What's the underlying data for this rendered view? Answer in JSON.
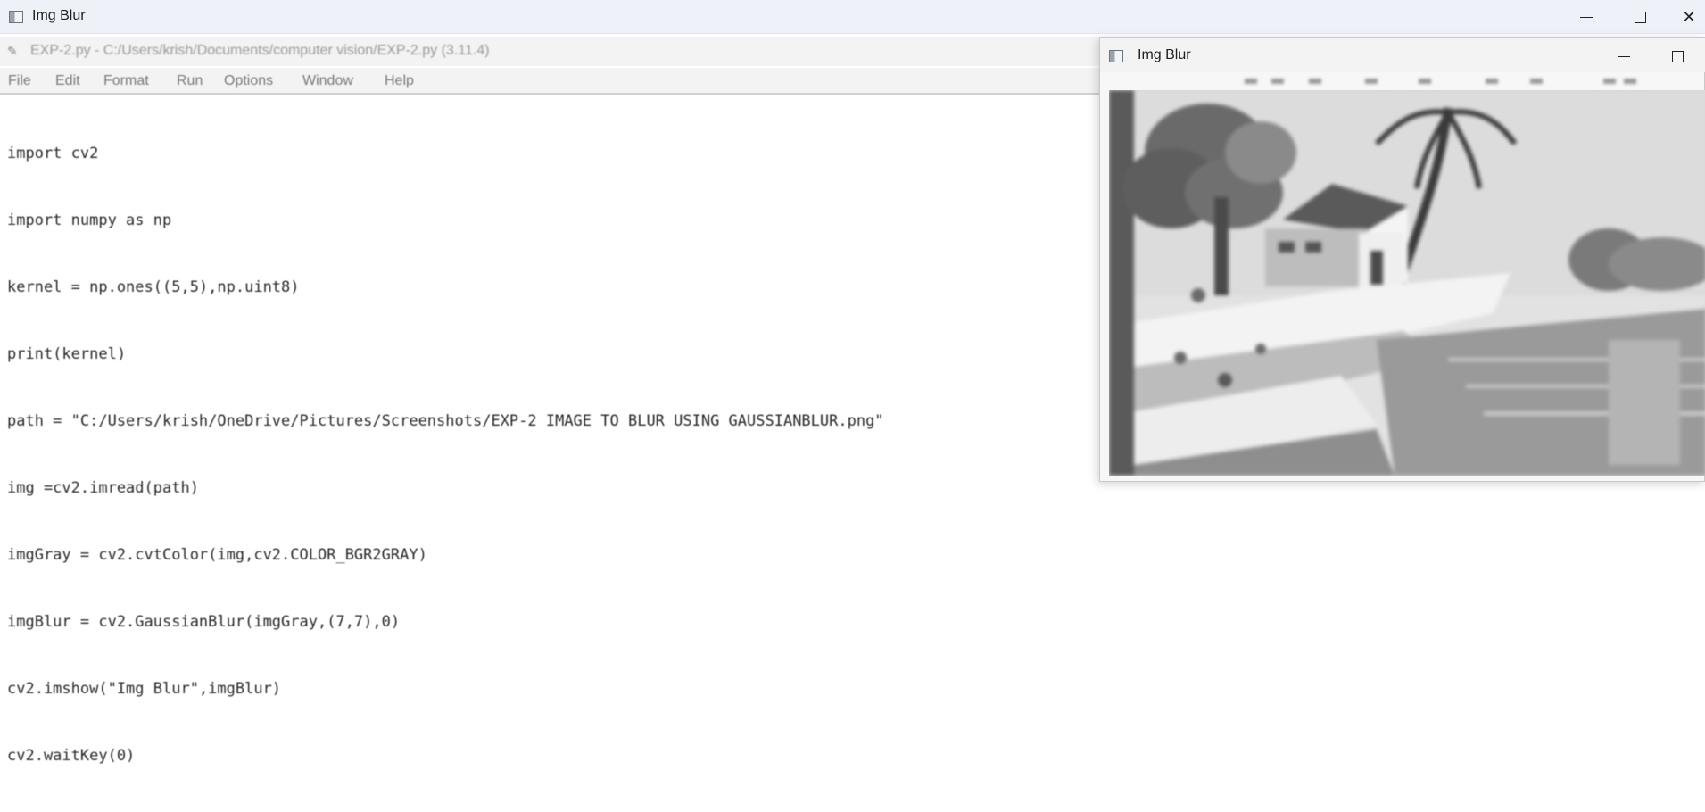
{
  "outer_window": {
    "title": "Img Blur",
    "icons": [
      "app-icon",
      "minimize-icon",
      "maximize-icon",
      "close-icon"
    ]
  },
  "idle_editor": {
    "title": "EXP-2.py - C:/Users/krish/Documents/computer vision/EXP-2.py (3.11.4)",
    "menu": [
      "File",
      "Edit",
      "Format",
      "Run",
      "Options",
      "Window",
      "Help"
    ],
    "code_lines": [
      "import cv2",
      "import numpy as np",
      "kernel = np.ones((5,5),np.uint8)",
      "print(kernel)",
      "path = \"C:/Users/krish/OneDrive/Pictures/Screenshots/EXP-2 IMAGE TO BLUR USING GAUSSIANBLUR.png\"",
      "img =cv2.imread(path)",
      "imgGray = cv2.cvtColor(img,cv2.COLOR_BGR2GRAY)",
      "imgBlur = cv2.GaussianBlur(imgGray,(7,7),0)",
      "cv2.imshow(\"Img Blur\",imgBlur)",
      "cv2.waitKey(0)"
    ]
  },
  "image_window": {
    "title": "Img Blur",
    "image_description_icon": "blurred-grayscale-landscape-image"
  }
}
